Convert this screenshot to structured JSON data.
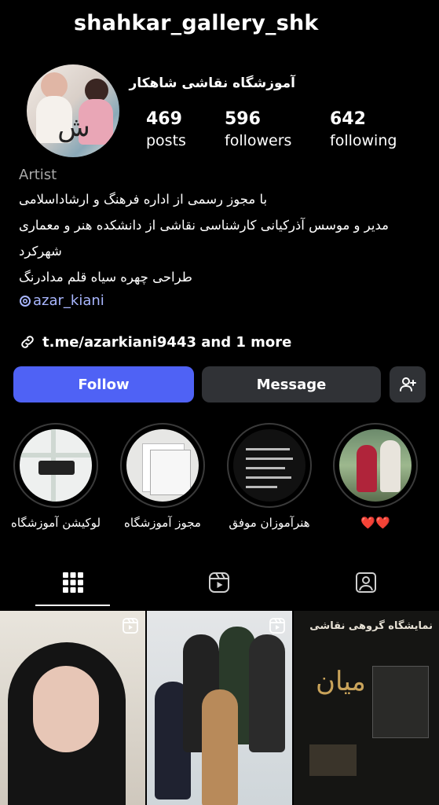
{
  "profile": {
    "username": "shahkar_gallery_shk",
    "display_name": "آموزشگاه نقاشی شاهکار",
    "stats": [
      {
        "value": "469",
        "label": "posts"
      },
      {
        "value": "596",
        "label": "followers"
      },
      {
        "value": "642",
        "label": "following"
      }
    ],
    "category": "Artist",
    "bio": [
      "با مجوز رسمی از اداره فرهنگ و ارشاداسلامی",
      "مدیر و موسس آذرکیانی کارشناسی نقاشی از دانشکده هنر و معماری",
      "شهرکرد",
      "طراحی چهره سیاه قلم مدادرنگ"
    ],
    "mention": "azar_kiani",
    "link": "t.me/azarkiani9443 and 1 more"
  },
  "actions": {
    "follow": "Follow",
    "message": "Message"
  },
  "highlights": [
    {
      "label": "لوکیشن آموزشگاه"
    },
    {
      "label": "مجوز آموزشگاه"
    },
    {
      "label": "هنرآموزان موفق"
    },
    {
      "label": "❤️❤️"
    }
  ],
  "posts": {
    "post3_title": "نمایشگاه گروهی نقاشی"
  },
  "colors": {
    "accent": "#4f62f5",
    "button_secondary": "#303236",
    "background": "#000000",
    "muted_text": "#a8a8a8",
    "mention": "#a9b7ff"
  },
  "icons": [
    "threads-icon",
    "link-icon",
    "add-user-icon",
    "grid-icon",
    "reels-icon",
    "tagged-icon",
    "reel-icon"
  ]
}
